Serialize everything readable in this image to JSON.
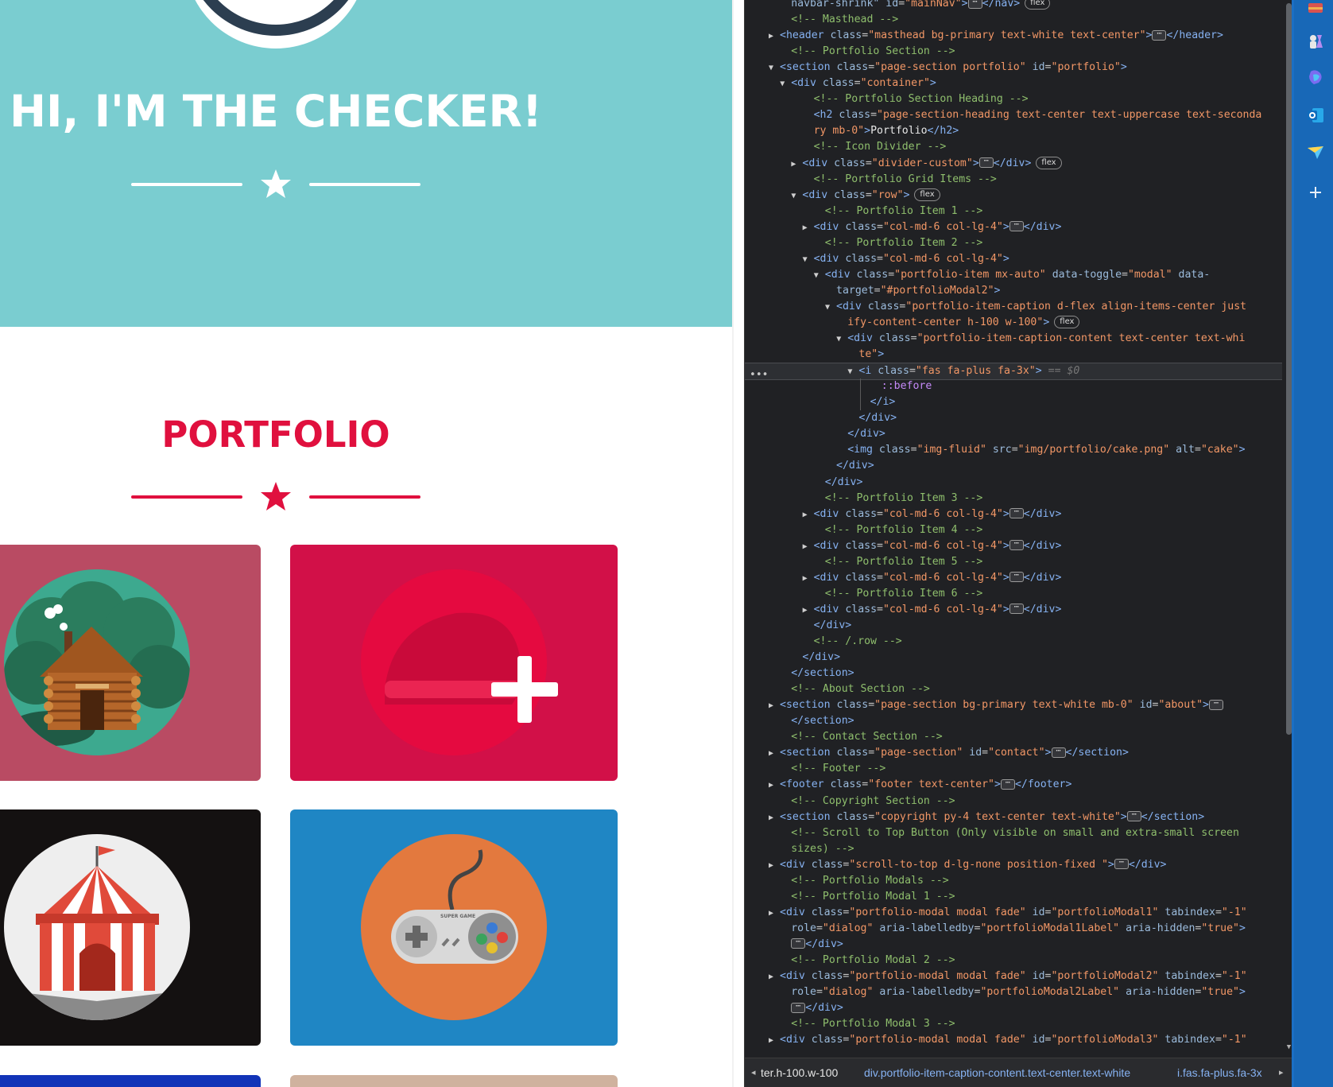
{
  "page": {
    "masthead": {
      "heading": "HI, I'M THE CHECKER!",
      "bg": "#7acdd0"
    },
    "portfolio": {
      "heading": "PORTFOLIO",
      "accent": "#e0103e",
      "tiles": [
        {
          "name": "cabin",
          "bg": "#b94b63"
        },
        {
          "name": "cake",
          "bg": "#d21048",
          "hover_icon": "plus-icon"
        },
        {
          "name": "circus",
          "bg": "#141111"
        },
        {
          "name": "game",
          "bg": "#1f86c4",
          "controller_text": "SUPER GAME"
        },
        {
          "name": "item-5",
          "bg": "#1234b8"
        },
        {
          "name": "item-6",
          "bg": "#cfb29e"
        }
      ]
    }
  },
  "devtools": {
    "lines": [
      {
        "i": 4,
        "h": "<span class=\"an\">navbar-shrink\"</span> <span class=\"an\">id</span>=<span class=\"av\">\"mainNav\"</span><span class=\"tag\">&gt;</span><span class=\"ell\">⋯</span><span class=\"tag\">&lt;/nav&gt;</span><span class=\"badge\">flex</span>"
      },
      {
        "i": 4,
        "h": "<span class=\"cm\">&lt;!-- Masthead --&gt;</span>"
      },
      {
        "i": 3,
        "t": "c",
        "h": "<span class=\"tag\">&lt;header</span> <span class=\"an\">class</span>=<span class=\"av\">\"masthead bg-primary text-white text-center\"</span><span class=\"tag\">&gt;</span><span class=\"ell\">⋯</span><span class=\"tag\">&lt;/header&gt;</span>"
      },
      {
        "i": 4,
        "h": "<span class=\"cm\">&lt;!-- Portfolio Section --&gt;</span>"
      },
      {
        "i": 3,
        "t": "o",
        "h": "<span class=\"tag\">&lt;section</span> <span class=\"an\">class</span>=<span class=\"av\">\"page-section portfolio\"</span> <span class=\"an\">id</span>=<span class=\"av\">\"portfolio\"</span><span class=\"tag\">&gt;</span>"
      },
      {
        "i": 4,
        "t": "o",
        "h": "<span class=\"tag\">&lt;div</span> <span class=\"an\">class</span>=<span class=\"av\">\"container\"</span><span class=\"tag\">&gt;</span>"
      },
      {
        "i": 6,
        "h": "<span class=\"cm\">&lt;!-- Portfolio Section Heading --&gt;</span>"
      },
      {
        "i": 6,
        "h": "<span class=\"tag\">&lt;h2</span> <span class=\"an\">class</span>=<span class=\"av\">\"page-section-heading text-center text-uppercase text-seconda</span>"
      },
      {
        "i": 6,
        "h": "<span class=\"av\">ry mb-0\"</span><span class=\"tag\">&gt;</span><span class=\"tx\">Portfolio</span><span class=\"tag\">&lt;/h2&gt;</span>"
      },
      {
        "i": 6,
        "h": "<span class=\"cm\">&lt;!-- Icon Divider --&gt;</span>"
      },
      {
        "i": 5,
        "t": "c",
        "h": "<span class=\"tag\">&lt;div</span> <span class=\"an\">class</span>=<span class=\"av\">\"divider-custom\"</span><span class=\"tag\">&gt;</span><span class=\"ell\">⋯</span><span class=\"tag\">&lt;/div&gt;</span><span class=\"badge\">flex</span>"
      },
      {
        "i": 6,
        "h": "<span class=\"cm\">&lt;!-- Portfolio Grid Items --&gt;</span>"
      },
      {
        "i": 5,
        "t": "o",
        "h": "<span class=\"tag\">&lt;div</span> <span class=\"an\">class</span>=<span class=\"av\">\"row\"</span><span class=\"tag\">&gt;</span><span class=\"badge\">flex</span>"
      },
      {
        "i": 7,
        "h": "<span class=\"cm\">&lt;!-- Portfolio Item 1 --&gt;</span>"
      },
      {
        "i": 6,
        "t": "c",
        "h": "<span class=\"tag\">&lt;div</span> <span class=\"an\">class</span>=<span class=\"av\">\"col-md-6 col-lg-4\"</span><span class=\"tag\">&gt;</span><span class=\"ell\">⋯</span><span class=\"tag\">&lt;/div&gt;</span>"
      },
      {
        "i": 7,
        "h": "<span class=\"cm\">&lt;!-- Portfolio Item 2 --&gt;</span>"
      },
      {
        "i": 6,
        "t": "o",
        "h": "<span class=\"tag\">&lt;div</span> <span class=\"an\">class</span>=<span class=\"av\">\"col-md-6 col-lg-4\"</span><span class=\"tag\">&gt;</span>"
      },
      {
        "i": 7,
        "t": "o",
        "h": "<span class=\"tag\">&lt;div</span> <span class=\"an\">class</span>=<span class=\"av\">\"portfolio-item mx-auto\"</span> <span class=\"an\">data-toggle</span>=<span class=\"av\">\"modal\"</span> <span class=\"an\">data-</span>"
      },
      {
        "i": 8,
        "h": "<span class=\"an\">target</span>=<span class=\"av\">\"#portfolioModal2\"</span><span class=\"tag\">&gt;</span>"
      },
      {
        "i": 8,
        "t": "o",
        "h": "<span class=\"tag\">&lt;div</span> <span class=\"an\">class</span>=<span class=\"av\">\"portfolio-item-caption d-flex align-items-center just</span>"
      },
      {
        "i": 9,
        "h": "<span class=\"av\">ify-content-center h-100 w-100\"</span><span class=\"tag\">&gt;</span><span class=\"badge\">flex</span>"
      },
      {
        "i": 9,
        "t": "o",
        "h": "<span class=\"tag\">&lt;div</span> <span class=\"an\">class</span>=<span class=\"av\">\"portfolio-item-caption-content text-center text-whi</span>"
      },
      {
        "i": 10,
        "h": "<span class=\"av\">te\"</span><span class=\"tag\">&gt;</span>"
      },
      {
        "i": 10,
        "t": "o",
        "sel": true,
        "h": "<span class=\"tag\">&lt;i</span> <span class=\"an\">class</span>=<span class=\"av\">\"fas fa-plus fa-3x\"</span><span class=\"tag\">&gt;</span> <span class=\"dm\">== $0</span>"
      },
      {
        "i": 12,
        "h": "<span class=\"ps\">::before</span>"
      },
      {
        "i": 11,
        "h": "<span class=\"tag\">&lt;/i&gt;</span>"
      },
      {
        "i": 10,
        "h": "<span class=\"tag\">&lt;/div&gt;</span>"
      },
      {
        "i": 9,
        "h": "<span class=\"tag\">&lt;/div&gt;</span>"
      },
      {
        "i": 9,
        "h": "<span class=\"tag\">&lt;img</span> <span class=\"an\">class</span>=<span class=\"av\">\"img-fluid\"</span> <span class=\"an\">src</span>=<span class=\"av\">\"img/portfolio/cake.png\"</span> <span class=\"an\">alt</span>=<span class=\"av\">\"cake\"</span><span class=\"tag\">&gt;</span>"
      },
      {
        "i": 8,
        "h": "<span class=\"tag\">&lt;/div&gt;</span>"
      },
      {
        "i": 7,
        "h": "<span class=\"tag\">&lt;/div&gt;</span>"
      },
      {
        "i": 7,
        "h": "<span class=\"cm\">&lt;!-- Portfolio Item 3 --&gt;</span>"
      },
      {
        "i": 6,
        "t": "c",
        "h": "<span class=\"tag\">&lt;div</span> <span class=\"an\">class</span>=<span class=\"av\">\"col-md-6 col-lg-4\"</span><span class=\"tag\">&gt;</span><span class=\"ell\">⋯</span><span class=\"tag\">&lt;/div&gt;</span>"
      },
      {
        "i": 7,
        "h": "<span class=\"cm\">&lt;!-- Portfolio Item 4 --&gt;</span>"
      },
      {
        "i": 6,
        "t": "c",
        "h": "<span class=\"tag\">&lt;div</span> <span class=\"an\">class</span>=<span class=\"av\">\"col-md-6 col-lg-4\"</span><span class=\"tag\">&gt;</span><span class=\"ell\">⋯</span><span class=\"tag\">&lt;/div&gt;</span>"
      },
      {
        "i": 7,
        "h": "<span class=\"cm\">&lt;!-- Portfolio Item 5 --&gt;</span>"
      },
      {
        "i": 6,
        "t": "c",
        "h": "<span class=\"tag\">&lt;div</span> <span class=\"an\">class</span>=<span class=\"av\">\"col-md-6 col-lg-4\"</span><span class=\"tag\">&gt;</span><span class=\"ell\">⋯</span><span class=\"tag\">&lt;/div&gt;</span>"
      },
      {
        "i": 7,
        "h": "<span class=\"cm\">&lt;!-- Portfolio Item 6 --&gt;</span>"
      },
      {
        "i": 6,
        "t": "c",
        "h": "<span class=\"tag\">&lt;div</span> <span class=\"an\">class</span>=<span class=\"av\">\"col-md-6 col-lg-4\"</span><span class=\"tag\">&gt;</span><span class=\"ell\">⋯</span><span class=\"tag\">&lt;/div&gt;</span>"
      },
      {
        "i": 6,
        "h": "<span class=\"tag\">&lt;/div&gt;</span>"
      },
      {
        "i": 6,
        "h": "<span class=\"cm\">&lt;!-- /.row --&gt;</span>"
      },
      {
        "i": 5,
        "h": "<span class=\"tag\">&lt;/div&gt;</span>"
      },
      {
        "i": 4,
        "h": "<span class=\"tag\">&lt;/section&gt;</span>"
      },
      {
        "i": 4,
        "h": "<span class=\"cm\">&lt;!-- About Section --&gt;</span>"
      },
      {
        "i": 3,
        "t": "c",
        "h": "<span class=\"tag\">&lt;section</span> <span class=\"an\">class</span>=<span class=\"av\">\"page-section bg-primary text-white mb-0\"</span> <span class=\"an\">id</span>=<span class=\"av\">\"about\"</span><span class=\"tag\">&gt;</span><span class=\"ell\">⋯</span>"
      },
      {
        "i": 4,
        "h": "<span class=\"tag\">&lt;/section&gt;</span>"
      },
      {
        "i": 4,
        "h": "<span class=\"cm\">&lt;!-- Contact Section --&gt;</span>"
      },
      {
        "i": 3,
        "t": "c",
        "h": "<span class=\"tag\">&lt;section</span> <span class=\"an\">class</span>=<span class=\"av\">\"page-section\"</span> <span class=\"an\">id</span>=<span class=\"av\">\"contact\"</span><span class=\"tag\">&gt;</span><span class=\"ell\">⋯</span><span class=\"tag\">&lt;/section&gt;</span>"
      },
      {
        "i": 4,
        "h": "<span class=\"cm\">&lt;!-- Footer --&gt;</span>"
      },
      {
        "i": 3,
        "t": "c",
        "h": "<span class=\"tag\">&lt;footer</span> <span class=\"an\">class</span>=<span class=\"av\">\"footer text-center\"</span><span class=\"tag\">&gt;</span><span class=\"ell\">⋯</span><span class=\"tag\">&lt;/footer&gt;</span>"
      },
      {
        "i": 4,
        "h": "<span class=\"cm\">&lt;!-- Copyright Section --&gt;</span>"
      },
      {
        "i": 3,
        "t": "c",
        "h": "<span class=\"tag\">&lt;section</span> <span class=\"an\">class</span>=<span class=\"av\">\"copyright py-4 text-center text-white\"</span><span class=\"tag\">&gt;</span><span class=\"ell\">⋯</span><span class=\"tag\">&lt;/section&gt;</span>"
      },
      {
        "i": 4,
        "h": "<span class=\"cm\">&lt;!-- Scroll to Top Button (Only visible on small and extra-small screen</span>"
      },
      {
        "i": 4,
        "h": "<span class=\"cm\">sizes) --&gt;</span>"
      },
      {
        "i": 3,
        "t": "c",
        "h": "<span class=\"tag\">&lt;div</span> <span class=\"an\">class</span>=<span class=\"av\">\"scroll-to-top d-lg-none position-fixed \"</span><span class=\"tag\">&gt;</span><span class=\"ell\">⋯</span><span class=\"tag\">&lt;/div&gt;</span>"
      },
      {
        "i": 4,
        "h": "<span class=\"cm\">&lt;!-- Portfolio Modals --&gt;</span>"
      },
      {
        "i": 4,
        "h": "<span class=\"cm\">&lt;!-- Portfolio Modal 1 --&gt;</span>"
      },
      {
        "i": 3,
        "t": "c",
        "h": "<span class=\"tag\">&lt;div</span> <span class=\"an\">class</span>=<span class=\"av\">\"portfolio-modal modal fade\"</span> <span class=\"an\">id</span>=<span class=\"av\">\"portfolioModal1\"</span> <span class=\"an\">tabindex</span>=<span class=\"av\">\"-1\"</span>"
      },
      {
        "i": 4,
        "h": "<span class=\"an\">role</span>=<span class=\"av\">\"dialog\"</span> <span class=\"an\">aria-labelledby</span>=<span class=\"av\">\"portfolioModal1Label\"</span> <span class=\"an\">aria-hidden</span>=<span class=\"av\">\"true\"</span><span class=\"tag\">&gt;</span>"
      },
      {
        "i": 4,
        "h": "<span class=\"ell\">⋯</span><span class=\"tag\">&lt;/div&gt;</span>"
      },
      {
        "i": 4,
        "h": "<span class=\"cm\">&lt;!-- Portfolio Modal 2 --&gt;</span>"
      },
      {
        "i": 3,
        "t": "c",
        "h": "<span class=\"tag\">&lt;div</span> <span class=\"an\">class</span>=<span class=\"av\">\"portfolio-modal modal fade\"</span> <span class=\"an\">id</span>=<span class=\"av\">\"portfolioModal2\"</span> <span class=\"an\">tabindex</span>=<span class=\"av\">\"-1\"</span>"
      },
      {
        "i": 4,
        "h": "<span class=\"an\">role</span>=<span class=\"av\">\"dialog\"</span> <span class=\"an\">aria-labelledby</span>=<span class=\"av\">\"portfolioModal2Label\"</span> <span class=\"an\">aria-hidden</span>=<span class=\"av\">\"true\"</span><span class=\"tag\">&gt;</span>"
      },
      {
        "i": 4,
        "h": "<span class=\"ell\">⋯</span><span class=\"tag\">&lt;/div&gt;</span>"
      },
      {
        "i": 4,
        "h": "<span class=\"cm\">&lt;!-- Portfolio Modal 3 --&gt;</span>"
      },
      {
        "i": 3,
        "t": "c",
        "h": "<span class=\"tag\">&lt;div</span> <span class=\"an\">class</span>=<span class=\"av\">\"portfolio-modal modal fade\"</span> <span class=\"an\">id</span>=<span class=\"av\">\"portfolioModal3\"</span> <span class=\"an\">tabindex</span>=<span class=\"av\">\"-1\"</span>"
      }
    ],
    "breadcrumb": [
      "ter.h-100.w-100",
      "div.portfolio-item-caption-content.text-center.text-white",
      "i.fas.fa-plus.fa-3x"
    ],
    "selected_marker": "•••"
  },
  "edge_sidebar": {
    "icons": [
      "toolbox-icon",
      "chess-icon",
      "copilot-icon",
      "outlook-icon",
      "send-icon",
      "add-icon"
    ]
  }
}
